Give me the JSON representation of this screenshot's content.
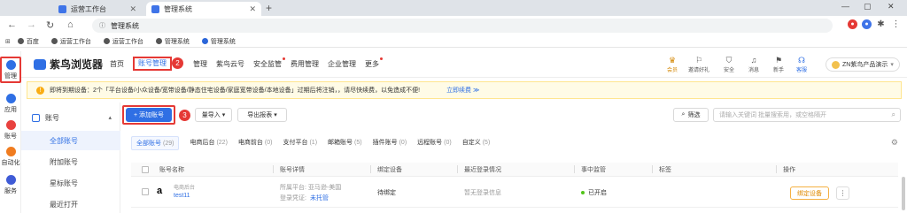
{
  "browser": {
    "tabs": [
      {
        "label": "运营工作台"
      },
      {
        "label": "管理系统"
      }
    ],
    "url": "管理系统",
    "bookmarks": [
      "百度",
      "运营工作台",
      "运营工作台",
      "管理系统",
      "管理系统"
    ]
  },
  "rail": {
    "items": [
      {
        "label": "管理",
        "color": "#2f6fe4"
      },
      {
        "label": "应用",
        "color": "#2f6fe4"
      },
      {
        "label": "账号",
        "color": "#e8413e"
      },
      {
        "label": "自动化",
        "color": "#f07c20"
      },
      {
        "label": "服务",
        "color": "#3f5bd6"
      }
    ],
    "step1": "1"
  },
  "header": {
    "logo": "紫鸟浏览器",
    "nav": [
      "首页",
      "账号管理",
      "管理",
      "紫鸟云号",
      "安全监管",
      "费用管理",
      "企业管理",
      "更多"
    ],
    "step2": "2",
    "tools": [
      {
        "label": "会员",
        "icon": "crown-icon"
      },
      {
        "label": "邀请好礼",
        "icon": "gift-icon"
      },
      {
        "label": "安全",
        "icon": "shield-icon"
      },
      {
        "label": "消息",
        "icon": "bell-icon"
      },
      {
        "label": "新手",
        "icon": "flag-icon"
      },
      {
        "label": "客服",
        "icon": "headset-icon"
      }
    ],
    "org": "ZN紫鸟产品演示"
  },
  "notice": {
    "text": "即将到期设备：2个「平台设备/小众设备/宽带设备/静态住宅设备/家庭宽带设备/本地设备」过期后将注销，，请尽快续费，以免造成不便!",
    "renew": "立即续费 ≫"
  },
  "sidebar": {
    "group": "账号",
    "items": [
      "全部账号",
      "附加账号",
      "星标账号",
      "最近打开"
    ]
  },
  "toolbar": {
    "add": "+ 添加账号",
    "step3": "3",
    "import": "量导入 ▾",
    "export": "导出报表 ▾",
    "filter": "筛选",
    "search_placeholder": "请输入关键词 批量搜索用，或空格隔开"
  },
  "tabs": [
    {
      "label": "全部账号",
      "count": "(29)"
    },
    {
      "label": "电商后台",
      "count": "(22)"
    },
    {
      "label": "电商前台",
      "count": "(0)"
    },
    {
      "label": "支付平台",
      "count": "(1)"
    },
    {
      "label": "邮箱账号",
      "count": "(5)"
    },
    {
      "label": "插件账号",
      "count": "(0)"
    },
    {
      "label": "远程账号",
      "count": "(0)"
    },
    {
      "label": "自定义",
      "count": "(5)"
    }
  ],
  "table": {
    "headers": [
      "账号名称",
      "账号详情",
      "绑定设备",
      "最近登录情况",
      "事中监管",
      "标签",
      "操作"
    ],
    "rows": [
      {
        "type": "电商后台",
        "name": "test11",
        "platform": "所属平台: 亚马逊-美国",
        "credential_label": "登录凭证:",
        "credential": "未托管",
        "device": "待绑定",
        "login": "暂无登录信息",
        "monitor": "已开启",
        "action": "绑定设备",
        "more": "⋮"
      }
    ]
  }
}
